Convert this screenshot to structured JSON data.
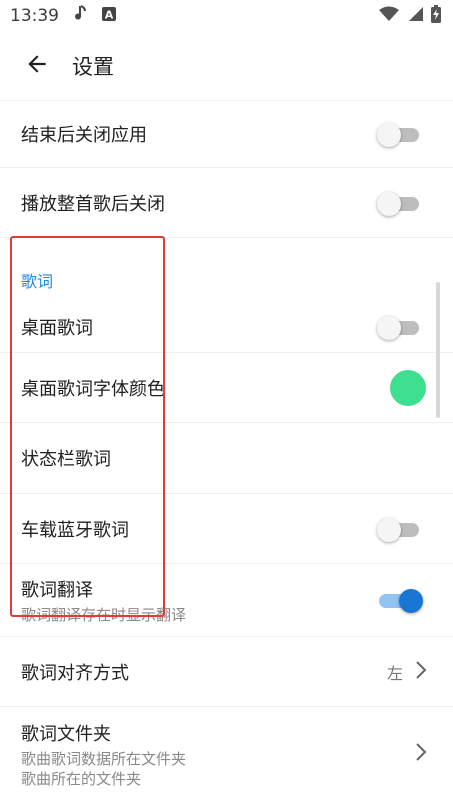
{
  "status_bar": {
    "time": "13:39",
    "icons": [
      "music-note-icon",
      "a-badge-icon",
      "wifi-icon",
      "signal-icon",
      "battery-charging-icon"
    ]
  },
  "app_bar": {
    "title": "设置",
    "back_icon": "arrow-left-icon"
  },
  "settings": {
    "close_app_after_end": {
      "label": "结束后关闭应用",
      "enabled": false
    },
    "close_after_song": {
      "label": "播放整首歌后关闭",
      "enabled": false
    },
    "lyrics_section_title": "歌词",
    "desktop_lyrics": {
      "label": "桌面歌词",
      "enabled": false
    },
    "desktop_lyrics_color": {
      "label": "桌面歌词字体颜色",
      "color": "#3ee08f"
    },
    "statusbar_lyrics": {
      "label": "状态栏歌词"
    },
    "bluetooth_lyrics": {
      "label": "车载蓝牙歌词",
      "enabled": false
    },
    "lyrics_translation": {
      "label": "歌词翻译",
      "summary": "歌词翻译存在时显示翻译",
      "enabled": true
    },
    "lyrics_alignment": {
      "label": "歌词对齐方式",
      "value": "左"
    },
    "lyrics_folder": {
      "label": "歌词文件夹",
      "summary1": "歌曲歌词数据所在文件夹",
      "summary2": "歌曲所在的文件夹"
    }
  },
  "colors": {
    "accent": "#1e88e5",
    "highlight": "#e53935"
  }
}
